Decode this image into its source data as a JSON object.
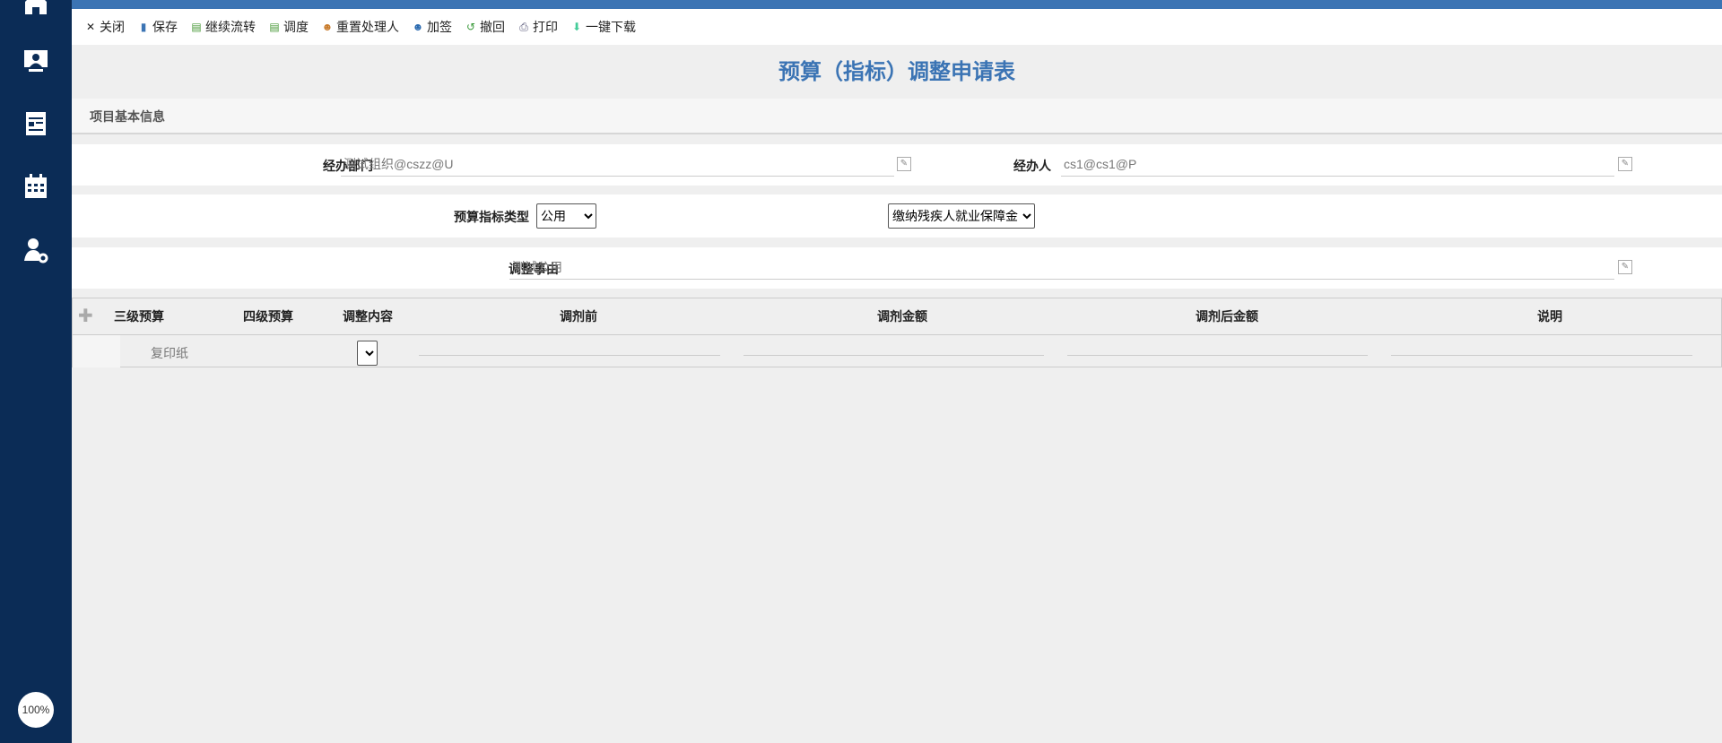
{
  "sidebar": {
    "items": [
      {
        "icon": "home-icon"
      },
      {
        "icon": "monitor-user-icon"
      },
      {
        "icon": "document-icon"
      },
      {
        "icon": "calendar-icon"
      },
      {
        "icon": "user-settings-icon"
      }
    ],
    "zoom": "100%"
  },
  "toolbar": {
    "items": [
      {
        "label": "关闭",
        "icon": "close-icon",
        "glyph": "✕",
        "color": "#222"
      },
      {
        "label": "保存",
        "icon": "save-icon",
        "glyph": "▮",
        "color": "#3b74b4"
      },
      {
        "label": "继续流转",
        "icon": "forward-icon",
        "glyph": "▤",
        "color": "#4a9a3a"
      },
      {
        "label": "调度",
        "icon": "dispatch-icon",
        "glyph": "▤",
        "color": "#4a9a3a"
      },
      {
        "label": "重置处理人",
        "icon": "reset-handler-icon",
        "glyph": "☻",
        "color": "#c87a2a"
      },
      {
        "label": "加签",
        "icon": "add-sign-icon",
        "glyph": "☻",
        "color": "#2a6ab0"
      },
      {
        "label": "撤回",
        "icon": "undo-icon",
        "glyph": "↺",
        "color": "#3a9a3a"
      },
      {
        "label": "打印",
        "icon": "print-icon",
        "glyph": "⎙",
        "color": "#557"
      },
      {
        "label": "一键下载",
        "icon": "download-icon",
        "glyph": "⬇",
        "color": "#4c9"
      }
    ]
  },
  "title": "预算（指标）调整申请表",
  "section": "项目基本信息",
  "form": {
    "dept_label": "经办部门",
    "dept_value": "测试组织@cszz@U",
    "handler_label": "经办人",
    "handler_value": "cs1@cs1@P",
    "type_label": "预算指标类型",
    "type_value": "公用",
    "item_value": "缴纳残疾人就业保障金",
    "reason_label": "调整事由",
    "reason_value": "测试公用"
  },
  "table": {
    "headers": [
      "三级预算",
      "四级预算",
      "调整内容",
      "调剂前",
      "调剂金额",
      "调剂后金额",
      "说明"
    ],
    "rows": [
      {
        "level3": "复印纸"
      }
    ]
  }
}
